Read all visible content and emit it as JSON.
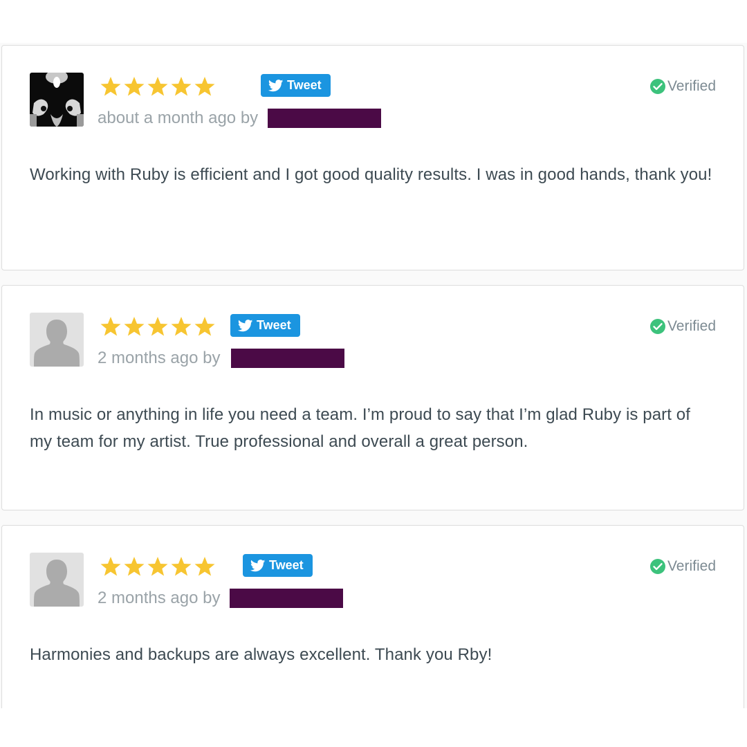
{
  "colors": {
    "star": "#f7c531",
    "tweet_button": "#1b95e0",
    "verified_check": "#3cc27c",
    "redaction_bar": "#4b0a46",
    "meta_text": "#9aa3a8",
    "body_text": "#3d4a52"
  },
  "reviews": [
    {
      "rating": 5,
      "avatar": "dark-photo-avatar",
      "tweet_label": "Tweet",
      "verified_label": "Verified",
      "meta": "about a month ago by",
      "text": "Working with Ruby is efficient and I got good quality results. I was in good hands, thank you!"
    },
    {
      "rating": 5,
      "avatar": "default-person-avatar",
      "tweet_label": "Tweet",
      "verified_label": "Verified",
      "meta": "2 months ago by",
      "text": "In music or anything in life you need a team. I’m proud to say that I’m glad Ruby is part of my team for my artist. True professional and overall a great person."
    },
    {
      "rating": 5,
      "avatar": "default-person-avatar",
      "tweet_label": "Tweet",
      "verified_label": "Verified",
      "meta": "2 months ago by",
      "text": "Harmonies and backups are always excellent. Thank you Rby!"
    }
  ]
}
